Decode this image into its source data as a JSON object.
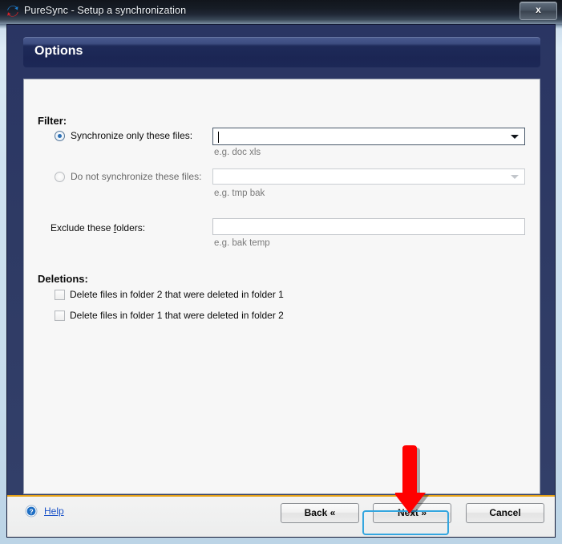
{
  "window": {
    "title": "PureSync - Setup a synchronization",
    "app_icon": "sync-arrows-icon",
    "close_label": "x"
  },
  "header": {
    "title": "Options"
  },
  "filter": {
    "section_title": "Filter:",
    "include": {
      "label": "Synchronize only these files:",
      "selected": true,
      "value": "",
      "hint": "e.g. doc xls"
    },
    "exclude": {
      "label": "Do not synchronize these files:",
      "selected": false,
      "value": "",
      "hint": "e.g. tmp bak"
    },
    "folders": {
      "label_prefix": "Exclude these ",
      "label_accel": "f",
      "label_suffix": "olders:",
      "value": "",
      "hint": "e.g. bak temp"
    }
  },
  "deletions": {
    "section_title": "Deletions:",
    "items": [
      {
        "label": "Delete files in folder 2 that were deleted in folder 1",
        "checked": false
      },
      {
        "label": "Delete files in folder 1 that were deleted in folder 2",
        "checked": false
      }
    ]
  },
  "footer": {
    "help_label": "Help",
    "help_icon": "question-mark-circle-icon",
    "back_label": "Back «",
    "next_label": "Next »",
    "cancel_label": "Cancel",
    "focused_button": "next"
  },
  "annotation": {
    "type": "down-arrow",
    "color": "#ff0000",
    "points_at": "next-button"
  },
  "colors": {
    "window_body": "#2e3a64",
    "banner": "#1e2a59",
    "panel": "#f7f7f7",
    "separator": "#e8a317",
    "focus_ring": "#34a6df",
    "link": "#1a52c8",
    "annotation": "#ff0000"
  }
}
